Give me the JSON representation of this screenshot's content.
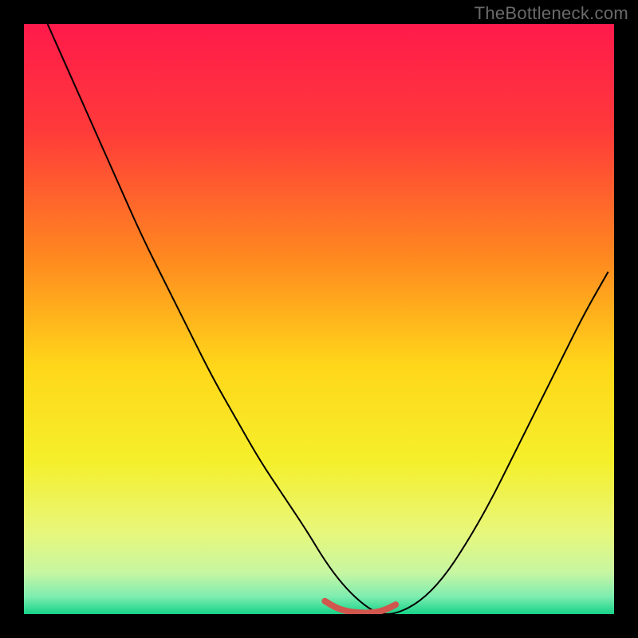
{
  "attribution": "TheBottleneck.com",
  "chart_data": {
    "type": "line",
    "title": "",
    "xlabel": "",
    "ylabel": "",
    "x_range": [
      0,
      100
    ],
    "y_range": [
      0,
      100
    ],
    "background_gradient": {
      "stops": [
        {
          "offset": 0.0,
          "color": "#ff1a4b"
        },
        {
          "offset": 0.18,
          "color": "#ff3a3a"
        },
        {
          "offset": 0.4,
          "color": "#ff8a1f"
        },
        {
          "offset": 0.58,
          "color": "#ffd71a"
        },
        {
          "offset": 0.74,
          "color": "#f5ef2a"
        },
        {
          "offset": 0.86,
          "color": "#e8f77a"
        },
        {
          "offset": 0.93,
          "color": "#c7f6a2"
        },
        {
          "offset": 0.97,
          "color": "#7eedb0"
        },
        {
          "offset": 1.0,
          "color": "#17d388"
        }
      ]
    },
    "series": [
      {
        "name": "bottleneck-curve",
        "color": "#000000",
        "width": 2.0,
        "x": [
          4,
          8,
          12,
          16,
          20,
          24,
          28,
          32,
          36,
          40,
          44,
          48,
          51,
          54,
          57,
          60,
          63,
          67,
          71,
          75,
          79,
          83,
          87,
          91,
          95,
          99
        ],
        "y": [
          100,
          91,
          82,
          73,
          64,
          56,
          48,
          40,
          33,
          26,
          20,
          14,
          9,
          5,
          2,
          0,
          0,
          2,
          6,
          12,
          19,
          27,
          35,
          43,
          51,
          58
        ]
      }
    ],
    "highlight": {
      "name": "sweet-spot",
      "color": "#d1564e",
      "width": 8,
      "x": [
        51,
        53,
        55,
        57,
        59,
        61,
        63
      ],
      "y": [
        2.2,
        1.0,
        0.4,
        0.2,
        0.2,
        0.6,
        1.6
      ]
    }
  }
}
